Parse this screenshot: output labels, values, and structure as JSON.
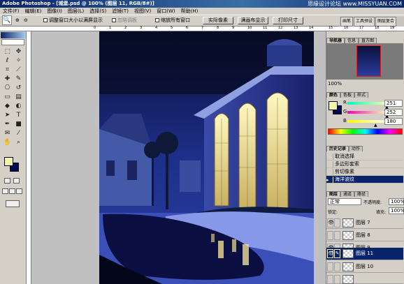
{
  "window": {
    "title": "Adobe Photoshop - [城堡.psd @ 100% (图层 11, RGB/8#)]",
    "watermark": "思缘设计论坛  www.MISSYUAN.COM"
  },
  "menu": [
    "文件(F)",
    "编辑(E)",
    "图像(I)",
    "图层(L)",
    "选择(S)",
    "滤镜(T)",
    "视图(V)",
    "窗口(W)",
    "帮助(H)"
  ],
  "options": {
    "zoom_in": "⊕",
    "zoom_out": "⊖",
    "resize_window": "调整窗口大小以满屏显示",
    "ignore_palettes": "忽略调板",
    "zoom_all": "缩放所有窗口",
    "actual_pixels": "实际像素",
    "fit_screen": "满画布显示",
    "print_size": "打印尺寸"
  },
  "palette_well": [
    "画笔",
    "工具预设",
    "图层复合"
  ],
  "ruler": {
    "top": [
      "0",
      "1",
      "2",
      "3",
      "4",
      "5",
      "6",
      "7",
      "8",
      "9",
      "10",
      "11",
      "12",
      "13",
      "14"
    ],
    "right_top": [
      "15",
      "16",
      "17",
      "18",
      "19"
    ]
  },
  "navigator": {
    "tabs": [
      "导航器",
      "信息",
      "直方图"
    ],
    "zoom": "100%"
  },
  "color": {
    "tabs": [
      "颜色",
      "色板",
      "样式"
    ],
    "r_label": "R",
    "g_label": "G",
    "b_label": "B",
    "r": "251",
    "g": "252",
    "b": "180",
    "r_val": 251,
    "g_val": 252,
    "b_val": 180
  },
  "history": {
    "tabs": [
      "历史记录",
      "动作"
    ],
    "items": [
      "取消选择",
      "多边形套索",
      "剪切像素",
      "海洋波纹"
    ],
    "selected": 3
  },
  "layers": {
    "tabs": [
      "图层",
      "通道",
      "路径"
    ],
    "blend_mode": "正常",
    "opacity_label": "不透明度:",
    "opacity": "100%",
    "lock_label": "锁定:",
    "fill_label": "填充:",
    "fill": "100%",
    "rows": [
      "图层 7",
      "图层 8",
      "图层 9",
      "图层 11",
      "图层 10"
    ],
    "selected": 3
  },
  "colors": {
    "titlebar": "#0a246a",
    "sky": "#1a2a7a",
    "window_glow": "#f0e8a0",
    "fg": "#f4f4a8",
    "bg": "#000a55"
  }
}
